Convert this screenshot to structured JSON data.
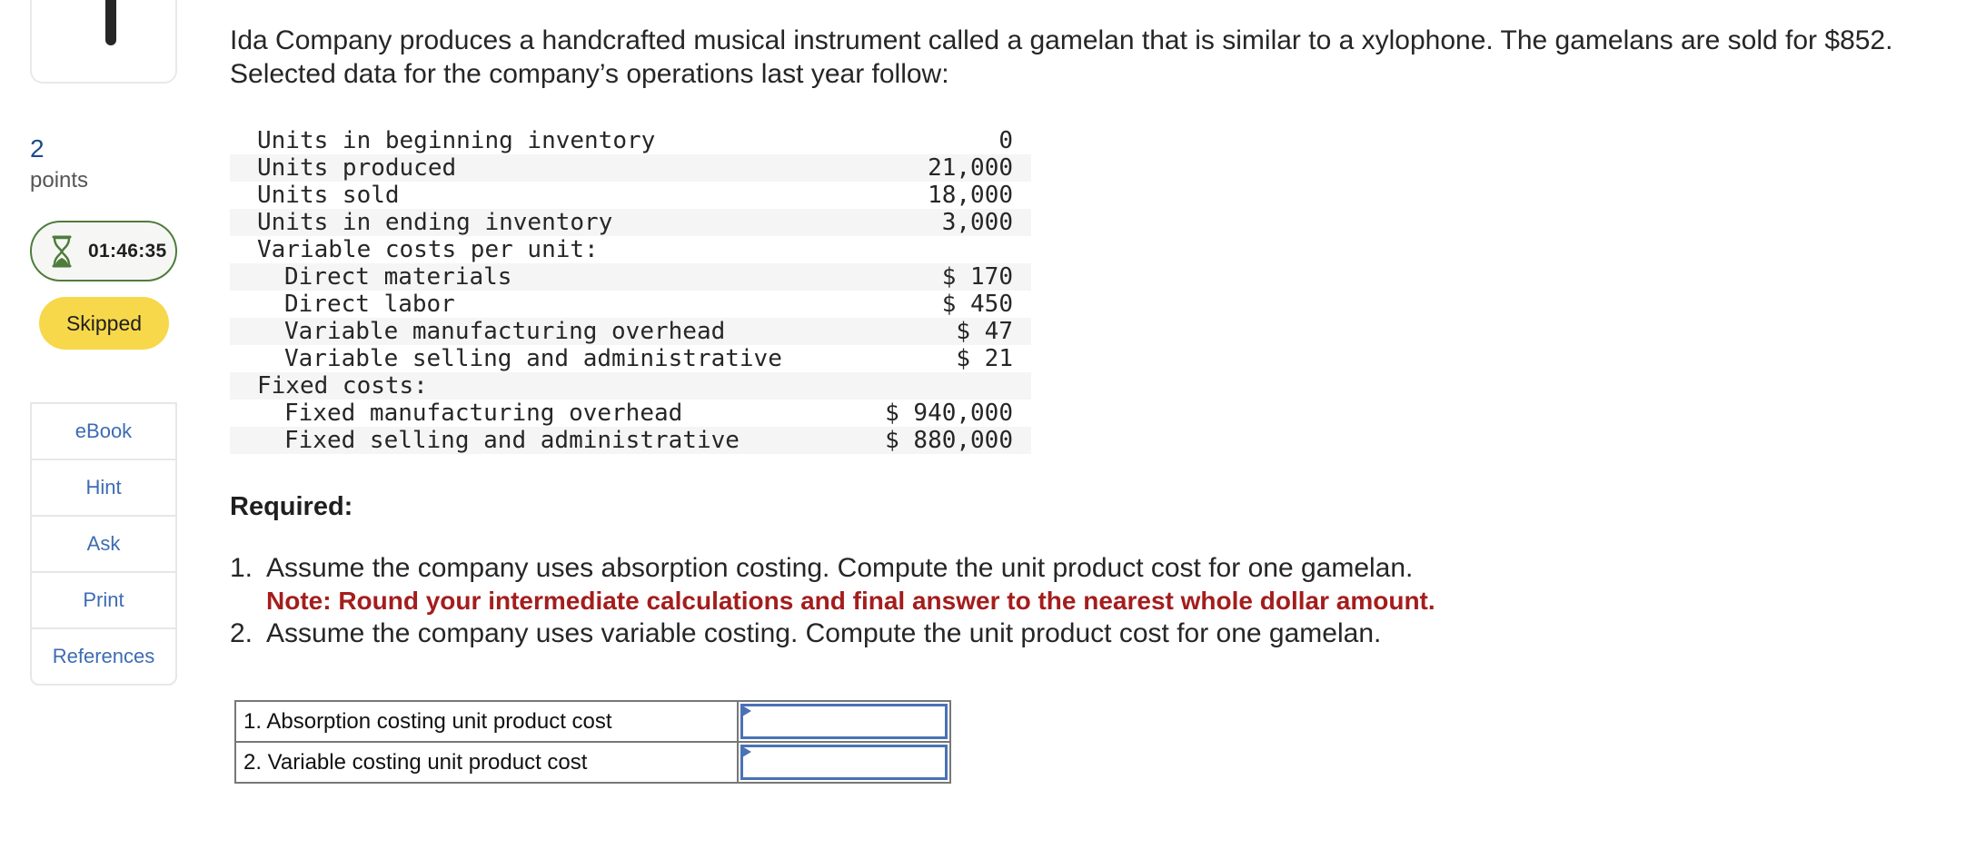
{
  "sidebar": {
    "points_value": "2",
    "points_label": "points",
    "timer": {
      "icon": "hourglass-icon",
      "value": "01:46:35"
    },
    "status": "Skipped",
    "tools": [
      {
        "label": "eBook"
      },
      {
        "label": "Hint"
      },
      {
        "label": "Ask"
      },
      {
        "label": "Print"
      },
      {
        "label": "References"
      }
    ]
  },
  "problem": {
    "intro": "Ida Company produces a handcrafted musical instrument called a gamelan that is similar to a xylophone. The gamelans are sold for $852. Selected data for the company’s operations last year follow:",
    "data_rows": [
      {
        "label": "Units in beginning inventory",
        "value": "0",
        "indent": false
      },
      {
        "label": "Units produced",
        "value": "21,000",
        "indent": false
      },
      {
        "label": "Units sold",
        "value": "18,000",
        "indent": false
      },
      {
        "label": "Units in ending inventory",
        "value": "3,000",
        "indent": false
      },
      {
        "label": "Variable costs per unit:",
        "value": "",
        "indent": false
      },
      {
        "label": "Direct materials",
        "value": "$ 170",
        "indent": true
      },
      {
        "label": "Direct labor",
        "value": "$ 450",
        "indent": true
      },
      {
        "label": "Variable manufacturing overhead",
        "value": "$ 47",
        "indent": true
      },
      {
        "label": "Variable selling and administrative",
        "value": "$ 21",
        "indent": true
      },
      {
        "label": "Fixed costs:",
        "value": "",
        "indent": false
      },
      {
        "label": "Fixed manufacturing overhead",
        "value": "$ 940,000",
        "indent": true
      },
      {
        "label": "Fixed selling and administrative",
        "value": "$ 880,000",
        "indent": true
      }
    ],
    "required_heading": "Required:",
    "requirements": [
      {
        "number": "1.",
        "text": "Assume the company uses absorption costing. Compute the unit product cost for one gamelan.",
        "note": "Note: Round your intermediate calculations and final answer to the nearest whole dollar amount."
      },
      {
        "number": "2.",
        "text": "Assume the company uses variable costing. Compute the unit product cost for one gamelan.",
        "note": ""
      }
    ],
    "answers": [
      {
        "label": "1. Absorption costing unit product cost",
        "value": ""
      },
      {
        "label": "2. Variable costing unit product cost",
        "value": ""
      }
    ]
  },
  "colors": {
    "accent_blue": "#3d6cb3",
    "timer_green": "#4f7c3d",
    "skipped_yellow": "#f7d84a",
    "note_red": "#a41d1d",
    "input_border": "#4a72b5"
  }
}
